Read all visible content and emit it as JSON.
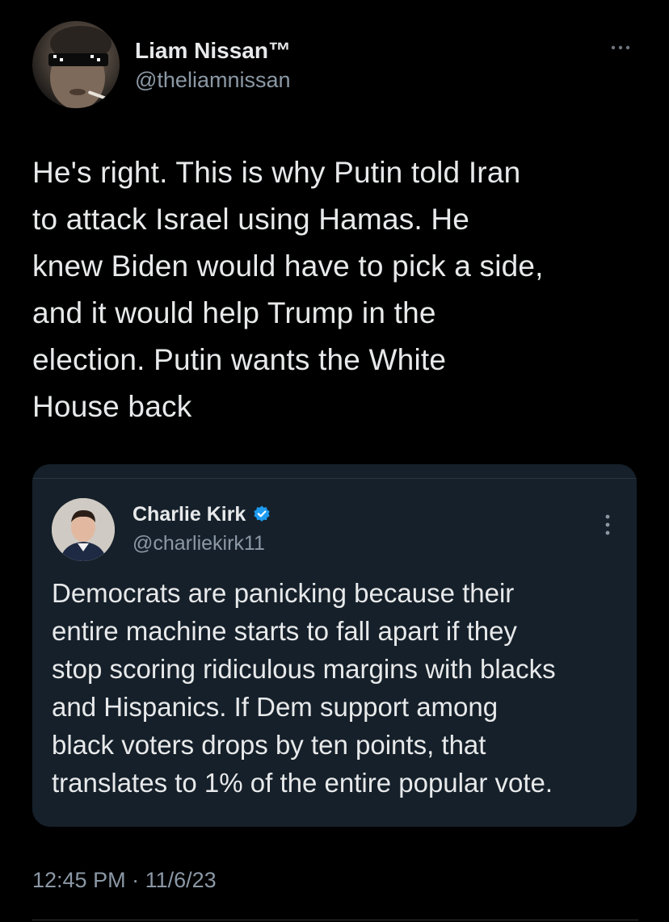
{
  "tweet": {
    "author_name": "Liam Nissan™",
    "author_handle": "@theliamnissan",
    "text": "He's right. This is why Putin told Iran\nto attack Israel using Hamas. He\nknew Biden would have to pick a side,\nand it would help Trump in the\nelection. Putin wants the White\nHouse back",
    "time": "12:45 PM",
    "separator": "·",
    "date": "11/6/23"
  },
  "quoted_tweet": {
    "author_name": "Charlie Kirk",
    "author_handle": "@charliekirk11",
    "verified": true,
    "text": "Democrats are panicking because their\nentire machine starts to fall apart if they\nstop scoring ridiculous margins with blacks\nand Hispanics. If Dem support among\nblack voters drops by ten points, that\ntranslates to 1% of the entire popular vote."
  },
  "icons": {
    "more_main": "more-horizontal-icon",
    "more_quote": "more-vertical-icon",
    "verified": "verified-badge-icon"
  },
  "colors": {
    "background": "#000000",
    "card_background": "#16202a",
    "primary_text": "#e7e9ea",
    "secondary_text": "#8b98a5",
    "verified_blue": "#1d9bf0"
  }
}
